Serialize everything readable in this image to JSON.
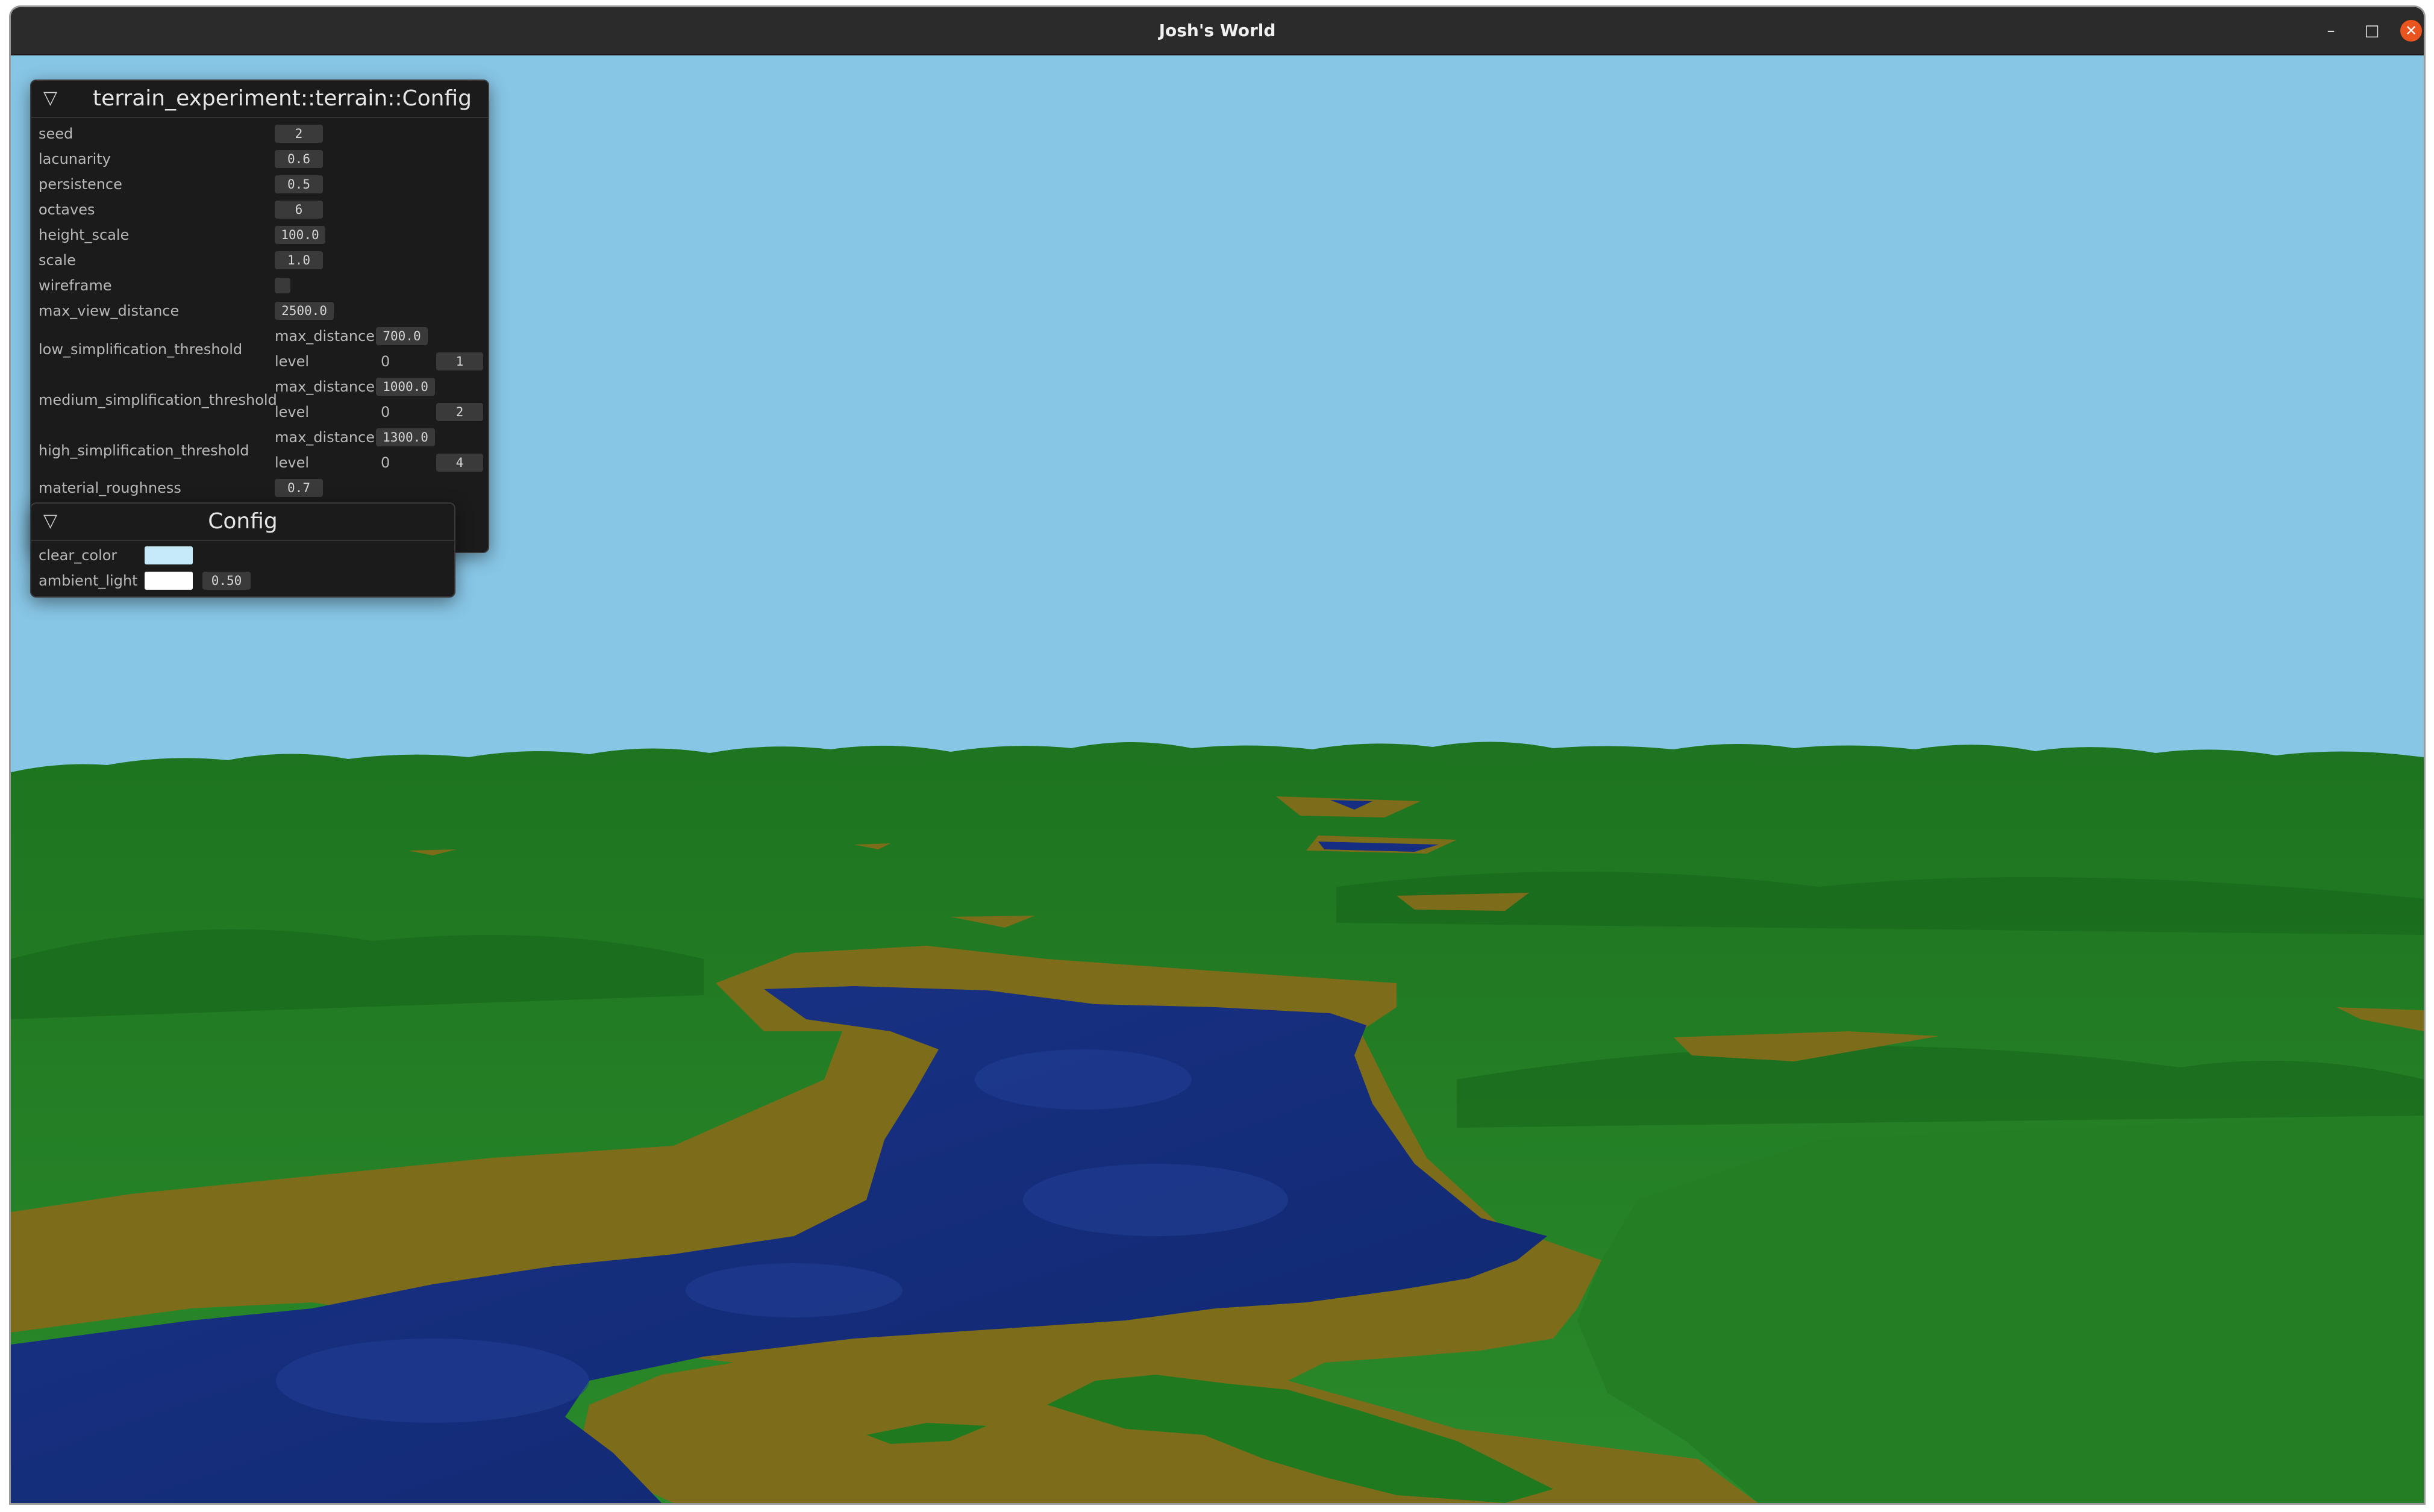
{
  "window": {
    "title": "Josh's World",
    "minimize_icon": "minimize-icon",
    "maximize_icon": "maximize-icon",
    "close_icon": "close-icon",
    "minimize_glyph": "–",
    "maximize_glyph": "□",
    "close_glyph": "✕"
  },
  "colors": {
    "sky": "#88c6e6",
    "grass": "#1f7a1f",
    "sand": "#7d6d1a",
    "water": "#152d82",
    "rock": "#6f6f6f",
    "close_button": "#e9541f"
  },
  "terrain_panel": {
    "title": "terrain_experiment::terrain::Config",
    "collapse_icon": "collapse-triangle-icon",
    "collapse_glyph": "▽",
    "fields": {
      "seed": {
        "label": "seed",
        "value": "2"
      },
      "lacunarity": {
        "label": "lacunarity",
        "value": "0.6"
      },
      "persistence": {
        "label": "persistence",
        "value": "0.5"
      },
      "octaves": {
        "label": "octaves",
        "value": "6"
      },
      "height_scale": {
        "label": "height_scale",
        "value": "100.0"
      },
      "scale": {
        "label": "scale",
        "value": "1.0"
      },
      "wireframe": {
        "label": "wireframe",
        "checked": false
      },
      "max_view_distance": {
        "label": "max_view_distance",
        "value": "2500.0"
      },
      "low": {
        "label": "low_simplification_threshold",
        "max_distance_label": "max_distance",
        "max_distance": "700.0",
        "level_label": "level",
        "level_min": "0",
        "level": "1"
      },
      "medium": {
        "label": "medium_simplification_threshold",
        "max_distance_label": "max_distance",
        "max_distance": "1000.0",
        "level_label": "level",
        "level_min": "0",
        "level": "2"
      },
      "high": {
        "label": "high_simplification_threshold",
        "max_distance_label": "max_distance",
        "max_distance": "1300.0",
        "level_label": "level",
        "level_min": "0",
        "level": "4"
      },
      "material_roughness": {
        "label": "material_roughness",
        "value": "0.7"
      }
    }
  },
  "config_panel": {
    "title": "Config",
    "collapse_glyph": "▽",
    "clear_color": {
      "label": "clear_color",
      "color": "#c6eaf8"
    },
    "ambient_light": {
      "label": "ambient_light",
      "color": "#ffffff",
      "value": "0.50"
    }
  }
}
